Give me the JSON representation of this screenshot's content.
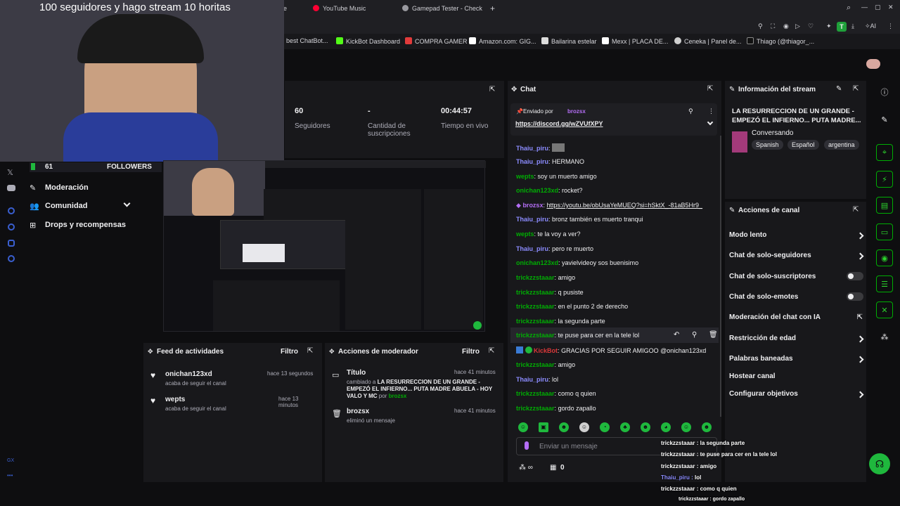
{
  "browser": {
    "tabs": [
      {
        "label": "e"
      },
      {
        "label": "YouTube Music"
      },
      {
        "label": "Gamepad Tester - Check"
      }
    ],
    "bookmarks": [
      "best ChatBot...",
      "KickBot Dashboard",
      "COMPRA GAMER",
      "Amazon.com: GIG...",
      "Bailarina estelar",
      "Mexx | PLACA DE...",
      "Ceneka | Panel de...",
      "Thiago (@thiagor_..."
    ],
    "profile_badge": "T",
    "ai_label": "AI"
  },
  "webcam": {
    "title": "100 seguidores y hago stream 10 horitas"
  },
  "followers_widget": {
    "count": "61",
    "label": "FOLLOWERS",
    "goal": "100"
  },
  "sidebar": {
    "items": [
      {
        "label": "Moderación"
      },
      {
        "label": "Comunidad"
      },
      {
        "label": "Drops y recompensas"
      }
    ],
    "footer": "GX"
  },
  "stats": {
    "followers_value": "60",
    "followers_label": "Seguidores",
    "subs_value": "-",
    "subs_label": "Cantidad de suscripciones",
    "live_value": "00:44:57",
    "live_label": "Tiempo en vivo"
  },
  "activity_feed": {
    "title": "Feed de actividades",
    "filter": "Filtro",
    "items": [
      {
        "user": "onichan123xd",
        "time": "hace 13 segundos",
        "desc": "acaba de seguir el canal"
      },
      {
        "user": "wepts",
        "time": "hace 13 minutos",
        "desc": "acaba de seguir el canal"
      }
    ]
  },
  "mod_actions": {
    "title": "Acciones de moderador",
    "filter": "Filtro",
    "items": [
      {
        "title": "Título",
        "time": "hace 41 minutos",
        "desc_prefix": "cambiado a",
        "desc_bold": "LA RESURRECCION DE UN GRANDE - EMPEZÓ EL INFIERNO... PUTA MADRE ABUELA - HOY VALO Y MC",
        "by": "por",
        "user": "brozsx"
      },
      {
        "title": "brozsx",
        "time": "hace 41 minutos",
        "desc_prefix": "eliminó un mensaje"
      }
    ]
  },
  "chat": {
    "title": "Chat",
    "pinned_by_label": "Enviado por",
    "pinned_by_user": "brozsx",
    "pinned_link": "https://discord.gg/wZVUfXPY",
    "messages": [
      {
        "user": "Thaiu_piru",
        "text": ""
      },
      {
        "user": "Thaiu_piru",
        "text": "HERMANO"
      },
      {
        "user": "wepts",
        "text": "soy un muerto amigo"
      },
      {
        "user": "onichan123xd",
        "text": "rocket?"
      },
      {
        "user": "brozsx",
        "text": "https://youtu.be/obUsaYeMUEQ?si=hSktX_-81aB5Hr9_"
      },
      {
        "user": "Thaiu_piru",
        "text": "bronz también es muerto tranqui"
      },
      {
        "user": "wepts",
        "text": "te la voy a ver?"
      },
      {
        "user": "Thaiu_piru",
        "text": "pero re muerto"
      },
      {
        "user": "onichan123xd",
        "text": "yavielvideoy sos buenisimo"
      },
      {
        "user": "trickzzstaaar",
        "text": "amigo"
      },
      {
        "user": "trickzzstaaar",
        "text": "q pusiste"
      },
      {
        "user": "trickzzstaaar",
        "text": "en el punto 2 de derecho"
      },
      {
        "user": "trickzzstaaar",
        "text": "la segunda parte"
      },
      {
        "user": "trickzzstaaar",
        "text": "te puse para cer en la tele lol"
      },
      {
        "user": "KickBot",
        "text": "GRACIAS POR SEGUIR AMIGOO @onichan123xd"
      },
      {
        "user": "trickzzstaaar",
        "text": "amigo"
      },
      {
        "user": "Thaiu_piru",
        "text": "lol"
      },
      {
        "user": "trickzzstaaar",
        "text": "como q quien"
      },
      {
        "user": "trickzzstaaar",
        "text": "gordo zapallo"
      }
    ],
    "input_placeholder": "Enviar un mensaje",
    "footer_count": "0"
  },
  "stream_info": {
    "title": "Información del stream",
    "stream_title": "LA RESURRECCION DE UN GRANDE - EMPEZÓ EL INFIERNO... PUTA MADRE...",
    "category": "Conversando",
    "tags": [
      "Spanish",
      "Español",
      "argentina"
    ]
  },
  "channel_actions": {
    "title": "Acciones de canal",
    "items": [
      {
        "label": "Modo lento"
      },
      {
        "label": "Chat de solo-seguidores"
      },
      {
        "label": "Chat de solo-suscriptores"
      },
      {
        "label": "Chat de solo-emotes"
      },
      {
        "label": "Moderación del chat con IA"
      },
      {
        "label": "Restricción de edad"
      },
      {
        "label": "Palabras baneadas"
      },
      {
        "label": "Hostear canal"
      },
      {
        "label": "Configurar objetivos"
      }
    ]
  },
  "overlay_chat": [
    {
      "user": "trickzzstaaar",
      "text": "la segunda parte"
    },
    {
      "user": "trickzzstaaar",
      "text": "te puse para cer en la tele lol"
    },
    {
      "user": "trickzzstaaar",
      "text": "amigo"
    },
    {
      "user": "Thaiu_piru",
      "text": "lol"
    },
    {
      "user": "trickzzstaaar",
      "text": "como q quien"
    },
    {
      "user": "trickzzstaaar",
      "text": "gordo zapallo"
    }
  ],
  "colors": {
    "accent": "#00ad03",
    "bg": "#0e0e10",
    "panel": "#18181b"
  }
}
